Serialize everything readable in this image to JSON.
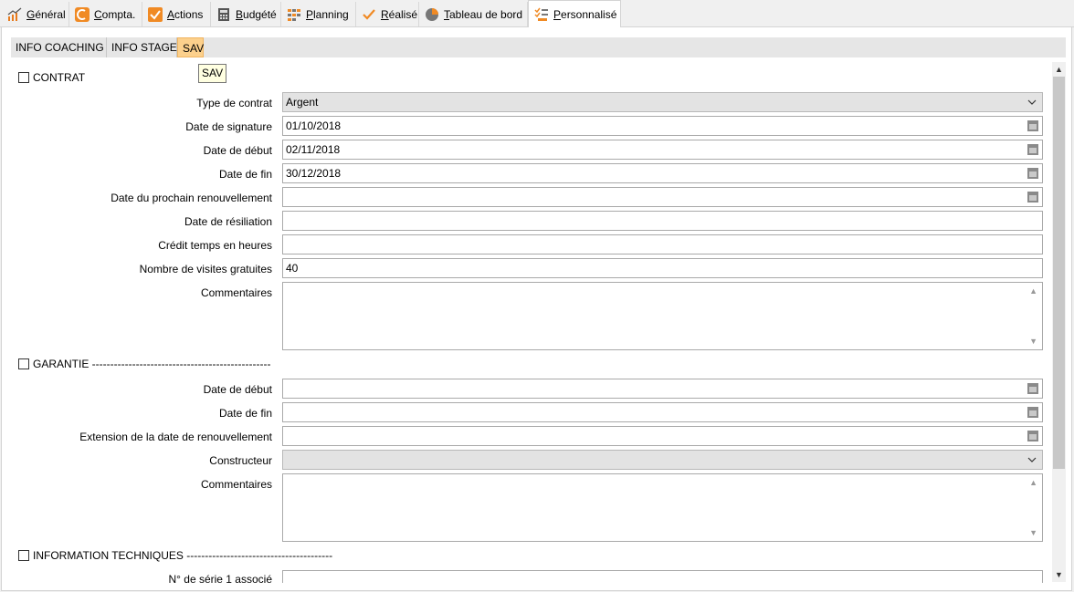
{
  "tabs": [
    {
      "label": "Général",
      "icon": "chart-up-icon"
    },
    {
      "label": "Compta.",
      "icon": "compta-icon"
    },
    {
      "label": "Actions",
      "icon": "checkbox-check-icon"
    },
    {
      "label": "Budgété",
      "icon": "calculator-icon"
    },
    {
      "label": "Planning",
      "icon": "planning-icon"
    },
    {
      "label": "Réalisé",
      "icon": "check-icon"
    },
    {
      "label": "Tableau de bord",
      "icon": "pie-chart-icon"
    },
    {
      "label": "Personnalisé",
      "icon": "personalize-icon"
    }
  ],
  "subtabs": [
    "INFO COACHING",
    "INFO STAGE",
    "SAV"
  ],
  "tooltip": "SAV",
  "contrat": {
    "title": "CONTRAT",
    "type_label": "Type de contrat",
    "type_value": "Argent",
    "signature_label": "Date de signature",
    "signature_value": "01/10/2018",
    "debut_label": "Date de début",
    "debut_value": "02/11/2018",
    "fin_label": "Date de fin",
    "fin_value": "30/12/2018",
    "renouv_label": "Date du prochain renouvellement",
    "renouv_value": "",
    "resil_label": "Date de résiliation",
    "resil_value": "",
    "credit_label": "Crédit temps en heures",
    "credit_value": "",
    "visites_label": "Nombre de visites gratuites",
    "visites_value": "40",
    "comm_label": "Commentaires"
  },
  "garantie": {
    "title": "GARANTIE -------------------------------------------------",
    "debut_label": "Date de début",
    "fin_label": "Date de fin",
    "ext_label": "Extension de la date de renouvellement",
    "constructeur_label": "Constructeur",
    "comm_label": "Commentaires"
  },
  "techniques": {
    "title": "INFORMATION TECHNIQUES ----------------------------------------",
    "serie_label": "N° de série 1 associé"
  }
}
